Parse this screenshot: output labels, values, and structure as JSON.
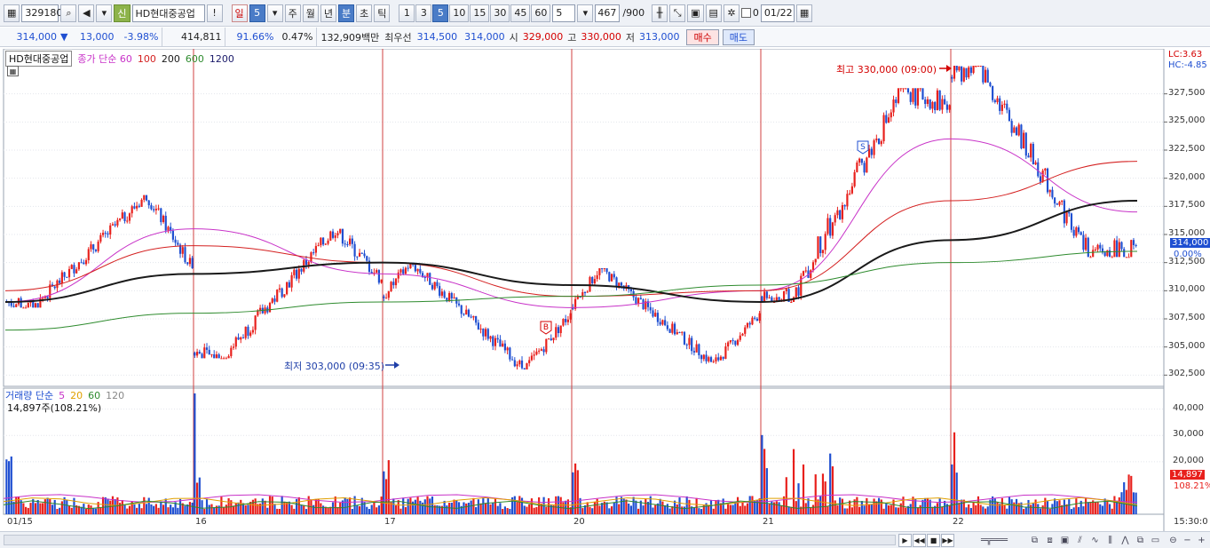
{
  "toolbar": {
    "code": "329180",
    "credit_badge": "신",
    "stock_name": "HD현대중공업",
    "alert": "!",
    "period_day": "일",
    "period_value": "5",
    "period_week": "주",
    "period_month": "월",
    "period_year": "년",
    "period_minute": "분",
    "period_second": "초",
    "period_tick": "틱",
    "interval_buttons": [
      "1",
      "3",
      "5",
      "10",
      "15",
      "30",
      "45",
      "60"
    ],
    "active_interval": "5",
    "custom_interval": "5",
    "count": "467",
    "count_total": "/900",
    "checkbox_label": "0",
    "date": "01/22"
  },
  "quote": {
    "price": "314,000",
    "change_arrow": "▼",
    "change": "13,000",
    "change_pct": "-3.98%",
    "volume": "414,811",
    "volume_ratio": "91.66%",
    "turnover": "0.47%",
    "amount": "132,909백만",
    "best_bid_label": "최우선",
    "best_ask": "314,500",
    "best_bid": "314,000",
    "open_label": "시",
    "open": "329,000",
    "high_label": "고",
    "high": "330,000",
    "low_label": "저",
    "low": "313,000",
    "buy_button": "매수",
    "sell_button": "매도"
  },
  "price_panel": {
    "stock_label": "HD현대중공업",
    "ma_label": "종가 단순 60",
    "ma_periods": [
      "100",
      "200",
      "600",
      "1200"
    ],
    "high_annotation": "최고 330,000 (09:00)",
    "low_annotation": "최저 303,000 (09:35)",
    "buy_marker": "B",
    "sell_marker": "S",
    "lc_label": "LC:3.63",
    "hc_label": "HC:-4.85",
    "current_price_tag": "314,000",
    "current_pct_tag": "0.00%"
  },
  "volume_panel": {
    "label": "거래량 단순",
    "ma_periods": [
      "5",
      "20",
      "60",
      "120"
    ],
    "current": "14,897주(108.21%)",
    "current_tag": "14,897",
    "current_pct_tag": "108.21%"
  },
  "time_axis": {
    "labels": [
      "01/15",
      "16",
      "17",
      "20",
      "21",
      "22"
    ],
    "right_label": "15:30:0"
  },
  "colors": {
    "up": "#e8201c",
    "down": "#1f4fd1",
    "ma60": "#c832c8",
    "ma100": "#d42020",
    "ma200": "#1a1a1a",
    "ma600": "#2e8b2e",
    "separator": "#d04040"
  },
  "chart_data": {
    "type": "candlestick",
    "title": "HD현대중공업",
    "y_ticks": [
      "327,500",
      "325,000",
      "322,500",
      "320,000",
      "317,500",
      "315,000",
      "312,500",
      "310,000",
      "307,500",
      "305,000",
      "302,500"
    ],
    "ylim": [
      301500,
      331500
    ],
    "volume_ticks": [
      "40,000",
      "30,000",
      "20,000"
    ],
    "volume_ylim": [
      0,
      48000
    ],
    "sessions": [
      {
        "label": "01/15",
        "open": 309000,
        "high": 318500,
        "low": 308500,
        "close": 312000
      },
      {
        "label": "16",
        "open": 304500,
        "high": 315500,
        "low": 304000,
        "close": 311000
      },
      {
        "label": "17",
        "open": 309500,
        "high": 312500,
        "low": 303000,
        "close": 308000
      },
      {
        "label": "20",
        "open": 308500,
        "high": 312000,
        "low": 303500,
        "close": 308000
      },
      {
        "label": "21",
        "open": 309500,
        "high": 328000,
        "low": 309000,
        "close": 326500
      },
      {
        "label": "22",
        "open": 329000,
        "high": 330000,
        "low": 313000,
        "close": 314000
      }
    ],
    "ma_series": [
      {
        "name": "60",
        "values": [
          309000,
          315500,
          311500,
          308500,
          310000,
          323500,
          317000
        ]
      },
      {
        "name": "100",
        "values": [
          310000,
          314000,
          312500,
          309500,
          310000,
          318000,
          321500
        ]
      },
      {
        "name": "200",
        "values": [
          309000,
          311500,
          312500,
          310500,
          309000,
          314500,
          318000
        ]
      },
      {
        "name": "600",
        "values": [
          306500,
          308000,
          309000,
          309500,
          310500,
          312500,
          313500
        ]
      }
    ]
  }
}
